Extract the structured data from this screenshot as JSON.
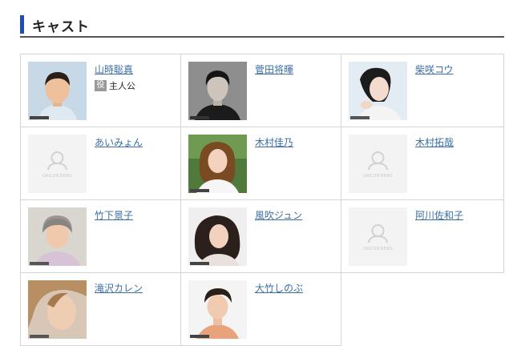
{
  "header": {
    "title": "キャスト"
  },
  "cast": [
    {
      "name": "山時聡真",
      "role_badge": "役",
      "role": "主人公",
      "photo": "photo"
    },
    {
      "name": "菅田将暉",
      "photo": "photo"
    },
    {
      "name": "柴咲コウ",
      "photo": "photo"
    },
    {
      "name": "あいみょん",
      "photo": "placeholder"
    },
    {
      "name": "木村佳乃",
      "photo": "photo"
    },
    {
      "name": "木村拓哉",
      "photo": "placeholder"
    },
    {
      "name": "竹下景子",
      "photo": "photo"
    },
    {
      "name": "風吹ジュン",
      "photo": "photo"
    },
    {
      "name": "阿川佐和子",
      "photo": "placeholder"
    },
    {
      "name": "滝沢カレン",
      "photo": "photo"
    },
    {
      "name": "大竹しのぶ",
      "photo": "photo"
    }
  ],
  "placeholder_text": "ORICON NEWS",
  "colors": {
    "accent_bar": "#1e4fb5",
    "link": "#3a6ea5",
    "border": "#d4d4d4",
    "badge": "#9a9a9a"
  }
}
